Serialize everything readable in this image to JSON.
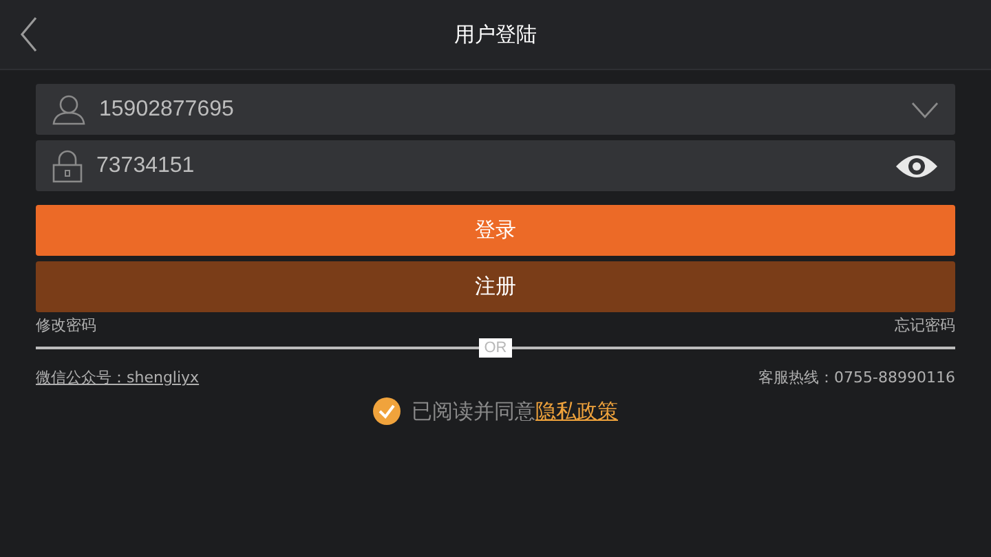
{
  "header": {
    "title": "用户登陆"
  },
  "account": {
    "value": "15902877695"
  },
  "password": {
    "value": "73734151"
  },
  "buttons": [
    {
      "label": "登录",
      "kind": "primary"
    },
    {
      "label": "注册",
      "kind": "secondary"
    }
  ],
  "links": {
    "change_password": "修改密码",
    "forgot_password": "忘记密码"
  },
  "divider": {
    "label": "OR"
  },
  "contacts": {
    "wechat": "微信公众号：shengliyx",
    "hotline": "客服热线：0755-88990116"
  },
  "agreement": {
    "checked": true,
    "text": "已阅读并同意",
    "link": "隐私政策"
  }
}
